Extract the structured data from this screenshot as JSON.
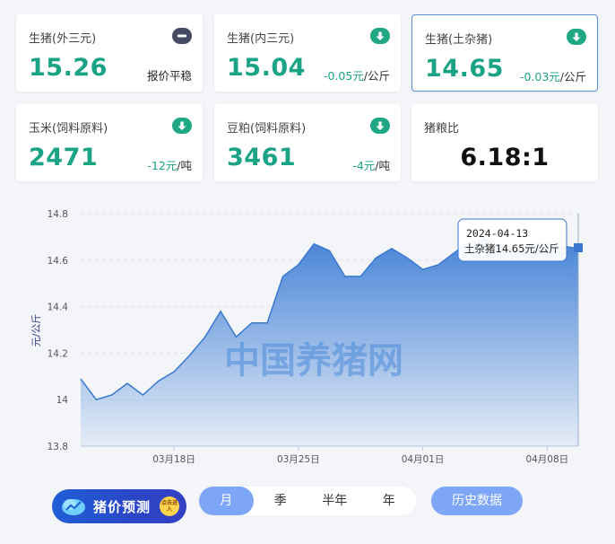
{
  "cards": [
    {
      "name": "生猪(外三元)",
      "price": "15.26",
      "change_text": "报价平稳",
      "change_num": "",
      "change_unit": "",
      "trend": "flat"
    },
    {
      "name": "生猪(内三元)",
      "price": "15.04",
      "change_text": "",
      "change_num": "-0.05元",
      "change_unit": "/公斤",
      "trend": "down"
    },
    {
      "name": "生猪(土杂猪)",
      "price": "14.65",
      "change_text": "",
      "change_num": "-0.03元",
      "change_unit": "/公斤",
      "trend": "down"
    },
    {
      "name": "玉米(饲料原料)",
      "price": "2471",
      "change_text": "",
      "change_num": "-12元",
      "change_unit": "/吨",
      "trend": "down"
    },
    {
      "name": "豆粕(饲料原料)",
      "price": "3461",
      "change_text": "",
      "change_num": "-4元",
      "change_unit": "/吨",
      "trend": "down"
    },
    {
      "name": "猪粮比",
      "price": "6.18:1"
    }
  ],
  "icons": {
    "flat": "minus-icon",
    "down": "arrow-down-icon"
  },
  "colors": {
    "accent": "#1aa384",
    "primary": "#7ea6f7",
    "chart_line": "#3f7fd6"
  },
  "watermark": "中国养猪网",
  "tooltip": {
    "date": "2024-04-13",
    "text": "土杂猪14.65元/公斤"
  },
  "predict_label": "猪价预测",
  "predict_badge": "点击进入",
  "periods": [
    "月",
    "季",
    "半年",
    "年"
  ],
  "active_period": "月",
  "history_label": "历史数据",
  "chart_data": {
    "type": "area",
    "ylabel": "元/公斤",
    "ylim": [
      13.8,
      14.8
    ],
    "yticks": [
      13.8,
      14,
      14.2,
      14.4,
      14.6,
      14.8
    ],
    "xtick_labels": [
      "03月18日",
      "03月25日",
      "04月01日",
      "04月08日"
    ],
    "xtick_index": [
      6,
      14,
      22,
      30
    ],
    "grid": true,
    "series": [
      {
        "values": [
          14.09,
          14.0,
          14.02,
          14.07,
          14.02,
          14.08,
          14.12,
          14.19,
          14.27,
          14.38,
          14.27,
          14.33,
          14.33,
          14.53,
          14.58,
          14.67,
          14.64,
          14.53,
          14.53,
          14.61,
          14.65,
          14.61,
          14.56,
          14.58,
          14.63,
          14.68,
          14.69,
          14.66,
          14.64,
          14.67,
          14.67,
          14.66,
          14.65
        ]
      }
    ]
  }
}
